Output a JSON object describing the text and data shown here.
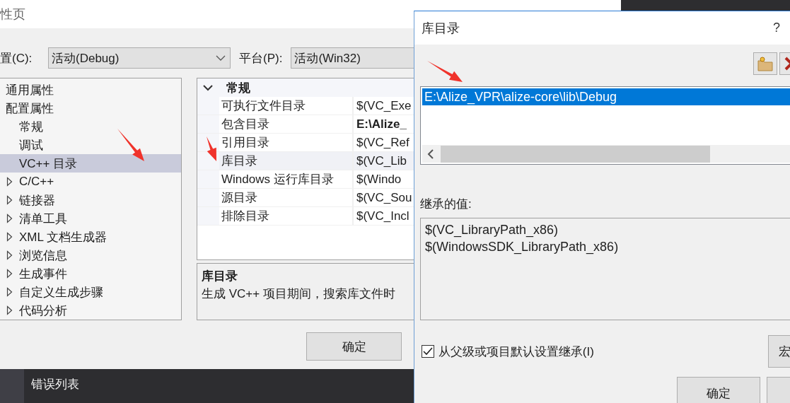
{
  "main_dialog": {
    "title": "性页",
    "config": {
      "label": "置(C):",
      "value": "活动(Debug)"
    },
    "platform": {
      "label": "平台(P):",
      "value": "活动(Win32)"
    },
    "tree": [
      {
        "label": "通用属性",
        "selected": false
      },
      {
        "label": "配置属性",
        "selected": false,
        "children": [
          {
            "label": "常规",
            "kind": "leaf",
            "selected": false
          },
          {
            "label": "调试",
            "kind": "leaf",
            "selected": false
          },
          {
            "label": "VC++ 目录",
            "kind": "leaf",
            "selected": true
          },
          {
            "label": "C/C++",
            "kind": "group",
            "expanded": false,
            "selected": false
          },
          {
            "label": "链接器",
            "kind": "group",
            "expanded": false,
            "selected": false
          },
          {
            "label": "清单工具",
            "kind": "group",
            "expanded": false,
            "selected": false
          },
          {
            "label": "XML 文档生成器",
            "kind": "group",
            "expanded": false,
            "selected": false
          },
          {
            "label": "浏览信息",
            "kind": "group",
            "expanded": false,
            "selected": false
          },
          {
            "label": "生成事件",
            "kind": "group",
            "expanded": false,
            "selected": false
          },
          {
            "label": "自定义生成步骤",
            "kind": "group",
            "expanded": false,
            "selected": false
          },
          {
            "label": "代码分析",
            "kind": "group",
            "expanded": false,
            "selected": false
          }
        ]
      }
    ],
    "grid": {
      "section": "常规",
      "expanded": true,
      "rows": [
        {
          "name": "可执行文件目录",
          "value": "$(VC_Exe",
          "bold": false,
          "selected": false
        },
        {
          "name": "包含目录",
          "value": "E:\\Alize_",
          "bold": true,
          "selected": false
        },
        {
          "name": "引用目录",
          "value": "$(VC_Ref",
          "bold": false,
          "selected": false
        },
        {
          "name": "库目录",
          "value": "$(VC_Lib",
          "bold": false,
          "selected": true
        },
        {
          "name": "Windows 运行库目录",
          "value": "$(Windo",
          "bold": false,
          "selected": false
        },
        {
          "name": "源目录",
          "value": "$(VC_Sou",
          "bold": false,
          "selected": false
        },
        {
          "name": "排除目录",
          "value": "$(VC_Incl",
          "bold": false,
          "selected": false
        }
      ]
    },
    "description": {
      "title": "库目录",
      "text": "生成 VC++ 项目期间，搜索库文件时"
    },
    "ok_button": "确定"
  },
  "output_panel": {
    "title": "错误列表"
  },
  "edit_dialog": {
    "title": "库目录",
    "help": "?",
    "entries": [
      {
        "text": "E:\\Alize_VPR\\alize-core\\lib\\Debug",
        "selected": true
      }
    ],
    "inherited_label": "继承的值:",
    "inherited_values": [
      "$(VC_LibraryPath_x86)",
      "$(WindowsSDK_LibraryPath_x86)"
    ],
    "inherit_checkbox": {
      "label": "从父级或项目默认设置继承(I)",
      "checked": true
    },
    "macro_button": "宏",
    "ok_button": "确定"
  }
}
